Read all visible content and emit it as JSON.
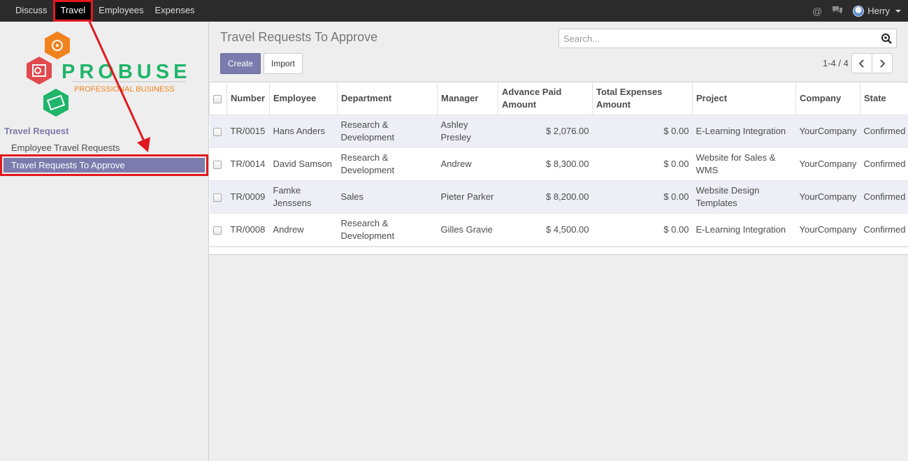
{
  "topbar": {
    "menu": [
      {
        "label": "Discuss"
      },
      {
        "label": "Travel"
      },
      {
        "label": "Employees"
      },
      {
        "label": "Expenses"
      }
    ],
    "icons": [
      "at-icon",
      "chat-icon"
    ],
    "user": "Herry"
  },
  "sidebar": {
    "logo": {
      "name": "PROBUSE",
      "tagline": "PROFESSIONAL BUSINESS"
    },
    "section": "Travel Request",
    "items": [
      {
        "label": "Employee Travel Requests"
      },
      {
        "label": "Travel Requests To Approve"
      }
    ]
  },
  "control_panel": {
    "title": "Travel Requests To Approve",
    "search_placeholder": "Search...",
    "create_label": "Create",
    "import_label": "Import",
    "pager": "1-4 / 4"
  },
  "table": {
    "headers": {
      "number": "Number",
      "employee": "Employee",
      "department": "Department",
      "manager": "Manager",
      "advance": "Advance Paid Amount",
      "total": "Total Expenses Amount",
      "project": "Project",
      "company": "Company",
      "state": "State"
    },
    "rows": [
      {
        "number": "TR/0015",
        "employee": "Hans Anders",
        "department": "Research & Development",
        "manager": "Ashley Presley",
        "advance": "$ 2,076.00",
        "total": "$ 0.00",
        "project": "E-Learning Integration",
        "company": "YourCompany",
        "state": "Confirmed"
      },
      {
        "number": "TR/0014",
        "employee": "David Samson",
        "department": "Research & Development",
        "manager": "Andrew",
        "advance": "$ 8,300.00",
        "total": "$ 0.00",
        "project": "Website for Sales & WMS",
        "company": "YourCompany",
        "state": "Confirmed"
      },
      {
        "number": "TR/0009",
        "employee": "Famke Jenssens",
        "department": "Sales",
        "manager": "Pieter Parker",
        "advance": "$ 8,200.00",
        "total": "$ 0.00",
        "project": "Website Design Templates",
        "company": "YourCompany",
        "state": "Confirmed"
      },
      {
        "number": "TR/0008",
        "employee": "Andrew",
        "department": "Research & Development",
        "manager": "Gilles Gravie",
        "advance": "$ 4,500.00",
        "total": "$ 0.00",
        "project": "E-Learning Integration",
        "company": "YourCompany",
        "state": "Confirmed"
      }
    ]
  },
  "colors": {
    "accent": "#7c7bad",
    "annotation": "#e0191f",
    "topbar": "#2b2b2b"
  }
}
